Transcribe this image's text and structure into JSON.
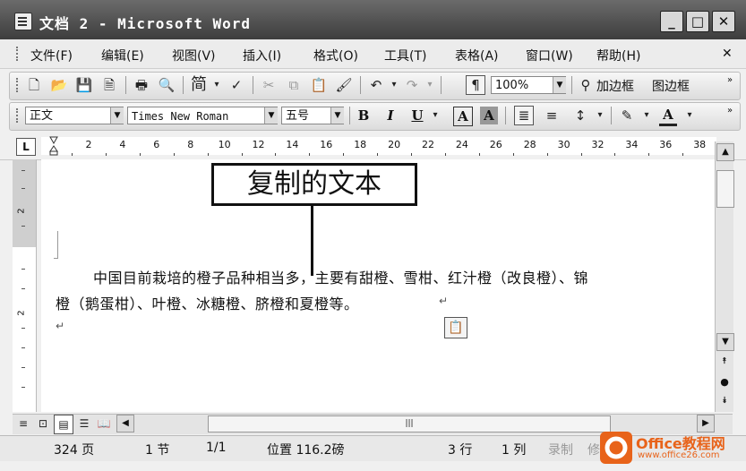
{
  "window": {
    "title": "文档 2 - Microsoft Word",
    "minimize": "_",
    "maximize": "□",
    "close": "✕"
  },
  "menu": {
    "items": [
      "文件(F)",
      "编辑(E)",
      "视图(V)",
      "插入(I)",
      "格式(O)",
      "工具(T)",
      "表格(A)",
      "窗口(W)",
      "帮助(H)"
    ],
    "close_doc": "✕"
  },
  "standard_toolbar": {
    "zoom": "100%",
    "add_border": "加边框",
    "picture_border": "图边框",
    "simplified_label": "简"
  },
  "format_toolbar": {
    "style": "正文",
    "font": "Times New Roman",
    "size": "五号",
    "bold": "B",
    "italic": "I",
    "underline": "U",
    "char_border": "A",
    "char_shade": "A",
    "font_color_label": "A"
  },
  "ruler": {
    "tab_selector": "L",
    "numbers": [
      "2",
      "4",
      "6",
      "8",
      "10",
      "12",
      "14",
      "16",
      "18",
      "20",
      "22",
      "24",
      "26",
      "28",
      "30",
      "32",
      "34",
      "36",
      "38"
    ]
  },
  "vruler": {
    "numbers": [
      "2",
      "2"
    ]
  },
  "document": {
    "line1": "中国目前栽培的橙子品种相当多，主要有甜橙、雪柑、红汁橙（改良橙）、锦",
    "line2": "橙（鹅蛋柑）、叶橙、冰糖橙、脐橙和夏橙等。",
    "para_mark": "↵"
  },
  "callout": {
    "text": "复制的文本"
  },
  "status_bar": {
    "page": "324 页",
    "section": "1 节",
    "page_of": "1/1",
    "position": "位置 116.2磅",
    "line": "3 行",
    "column": "1 列",
    "record": "录制",
    "revise": "修"
  },
  "watermark": {
    "brand": "Office教程网",
    "url": "www.office26.com"
  },
  "colors": {
    "titlebar": "#4a4a4a",
    "watermark_orange": "#e8631a"
  }
}
